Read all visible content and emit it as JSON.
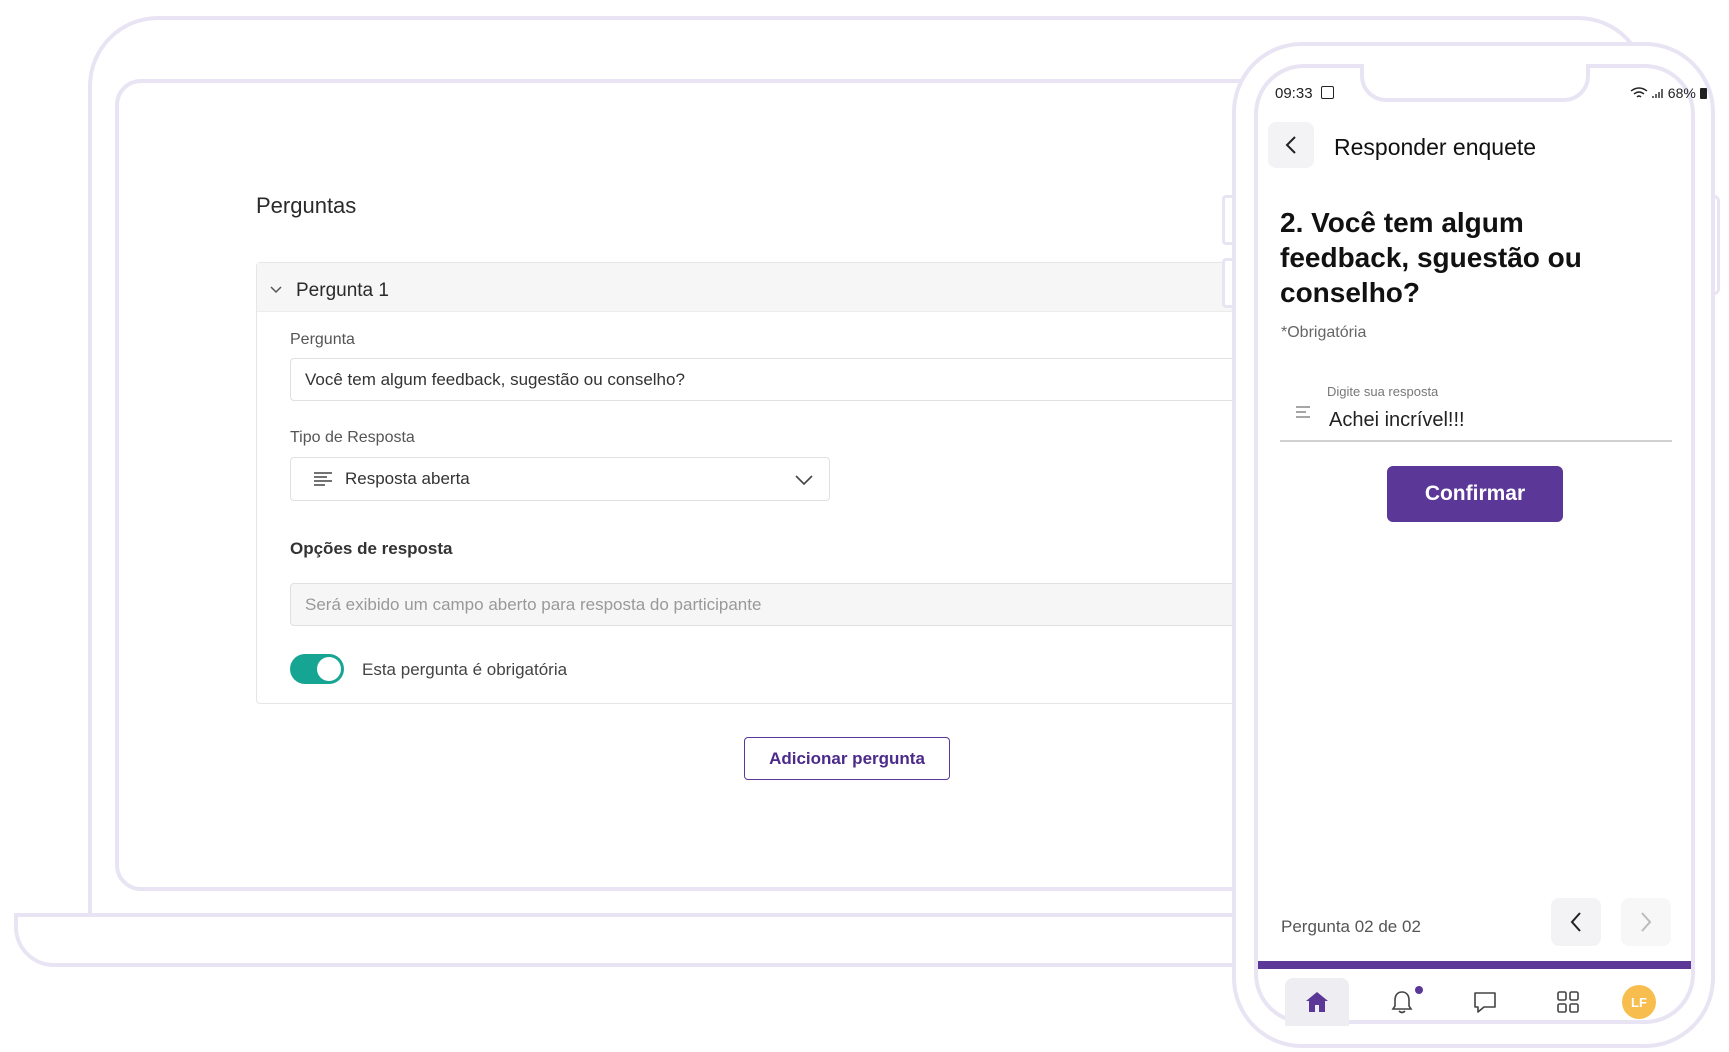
{
  "desktop": {
    "section_title": "Perguntas",
    "question_block": {
      "title": "Pergunta 1",
      "question_label": "Pergunta",
      "question_value": "Você tem algum feedback, sugestão ou conselho?",
      "type_label": "Tipo de Resposta",
      "type_value": "Resposta aberta",
      "options_label": "Opções de resposta",
      "options_placeholder": "Será exibido um campo aberto para resposta do participante",
      "required_label": "Esta pergunta é obrigatória",
      "required_on": true
    },
    "add_button": "Adicionar pergunta"
  },
  "mobile": {
    "status_time": "09:33",
    "status_battery": "68%",
    "header_title": "Responder enquete",
    "question": "2. Você tem algum feedback, sguestão ou conselho?",
    "required_note": "*Obrigatória",
    "input_label": "Digite sua resposta",
    "input_value": "Achei incrível!!!",
    "confirm_button": "Confirmar",
    "pager": "Pergunta 02 de 02",
    "avatar_initials": "LF"
  },
  "colors": {
    "brand": "#5b3898",
    "toggle": "#17a593",
    "frame": "#e9e4f3",
    "avatar": "#f7be4f"
  }
}
